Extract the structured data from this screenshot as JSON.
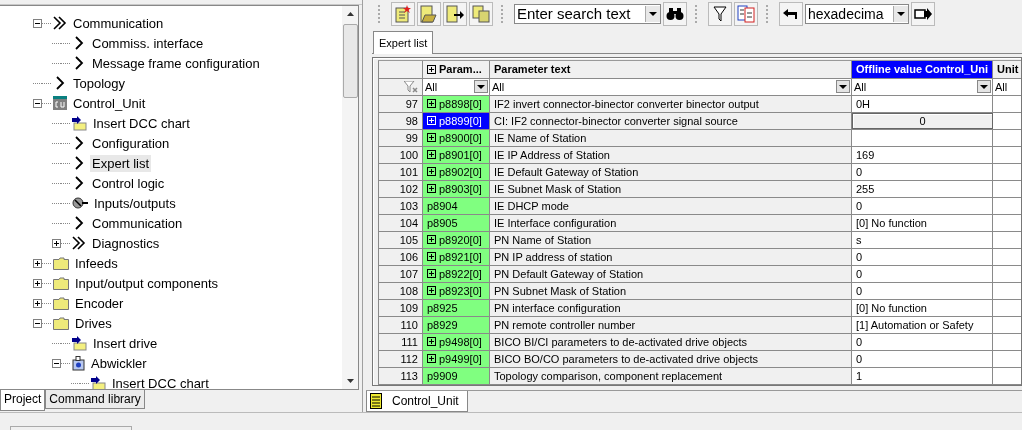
{
  "tree": [
    {
      "label": "Communication",
      "kind": "group",
      "expanded": true,
      "children": [
        {
          "label": "Commiss. interface",
          "kind": "view"
        },
        {
          "label": "Message frame configuration",
          "kind": "view"
        }
      ]
    },
    {
      "label": "Topology",
      "kind": "view"
    },
    {
      "label": "Control_Unit",
      "kind": "unit",
      "expanded": true,
      "children": [
        {
          "label": "Insert DCC chart",
          "kind": "insert"
        },
        {
          "label": "Configuration",
          "kind": "view"
        },
        {
          "label": "Expert list",
          "kind": "view",
          "selected": true
        },
        {
          "label": "Control logic",
          "kind": "view"
        },
        {
          "label": "Inputs/outputs",
          "kind": "io"
        },
        {
          "label": "Communication",
          "kind": "view"
        },
        {
          "label": "Diagnostics",
          "kind": "group",
          "expanded": false
        }
      ]
    },
    {
      "label": "Infeeds",
      "kind": "folder",
      "expanded": false
    },
    {
      "label": "Input/output components",
      "kind": "folder",
      "expanded": false
    },
    {
      "label": "Encoder",
      "kind": "folder",
      "expanded": false
    },
    {
      "label": "Drives",
      "kind": "folder",
      "expanded": true,
      "children": [
        {
          "label": "Insert drive",
          "kind": "insert"
        },
        {
          "label": "Abwickler",
          "kind": "drive",
          "expanded": true,
          "children": [
            {
              "label": "Insert DCC chart",
              "kind": "insert"
            }
          ]
        }
      ]
    }
  ],
  "left_tabs": [
    {
      "label": "Project",
      "selected": true
    },
    {
      "label": "Command library",
      "selected": false
    }
  ],
  "toolbar": {
    "search": {
      "value": "Enter search text"
    },
    "format": {
      "value": "hexadecima"
    }
  },
  "view_tabs": [
    {
      "label": "Expert list",
      "selected": true
    }
  ],
  "table": {
    "columns": [
      {
        "label": "Param...",
        "expander": true,
        "selected": false
      },
      {
        "label": "Parameter text",
        "selected": false
      },
      {
        "label": "Offline value Control_Uni",
        "selected": true
      },
      {
        "label": "Unit",
        "selected": false
      }
    ],
    "filters": [
      {
        "value": "All",
        "dropdown": true
      },
      {
        "value": "All",
        "dropdown": true
      },
      {
        "value": "All",
        "dropdown": true
      },
      {
        "value": "All",
        "dropdown": false
      }
    ],
    "rows": [
      {
        "number": "97",
        "parameter": "p8898[0]",
        "expandable": true,
        "text": "IF2 invert connector-binector converter binector output",
        "value": "0H",
        "selected": false
      },
      {
        "number": "98",
        "parameter": "p8899[0]",
        "expandable": true,
        "text": "CI: IF2 connector-binector converter signal source",
        "value": "0",
        "selected": true
      },
      {
        "number": "99",
        "parameter": "p8900[0]",
        "expandable": true,
        "text": "IE Name of Station",
        "selected": false
      },
      {
        "number": "100",
        "parameter": "p8901[0]",
        "expandable": true,
        "text": "IE IP Address of Station",
        "value": "169",
        "selected": false
      },
      {
        "number": "101",
        "parameter": "p8902[0]",
        "expandable": true,
        "text": "IE Default Gateway of Station",
        "value": "0",
        "selected": false
      },
      {
        "number": "102",
        "parameter": "p8903[0]",
        "expandable": true,
        "text": "IE Subnet Mask of Station",
        "value": "255",
        "selected": false
      },
      {
        "number": "103",
        "parameter": "p8904",
        "expandable": false,
        "text": "IE DHCP mode",
        "value": "0",
        "selected": false
      },
      {
        "number": "104",
        "parameter": "p8905",
        "expandable": false,
        "text": "IE Interface configuration",
        "value": "[0] No function",
        "selected": false
      },
      {
        "number": "105",
        "parameter": "p8920[0]",
        "expandable": true,
        "text": "PN Name of Station",
        "value": "s",
        "selected": false
      },
      {
        "number": "106",
        "parameter": "p8921[0]",
        "expandable": true,
        "text": "PN IP address of station",
        "value": "0",
        "selected": false
      },
      {
        "number": "107",
        "parameter": "p8922[0]",
        "expandable": true,
        "text": "PN Default Gateway of Station",
        "value": "0",
        "selected": false
      },
      {
        "number": "108",
        "parameter": "p8923[0]",
        "expandable": true,
        "text": "PN Subnet Mask of Station",
        "value": "0",
        "selected": false
      },
      {
        "number": "109",
        "parameter": "p8925",
        "expandable": false,
        "text": "PN interface configuration",
        "value": "[0] No function",
        "selected": false
      },
      {
        "number": "110",
        "parameter": "p8929",
        "expandable": false,
        "text": "PN remote controller number",
        "value": "[1] Automation or Safety",
        "selected": false
      },
      {
        "number": "111",
        "parameter": "p9498[0]",
        "expandable": true,
        "text": "BICO BI/CI parameters to de-activated drive objects",
        "value": "0",
        "selected": false
      },
      {
        "number": "112",
        "parameter": "p9499[0]",
        "expandable": true,
        "text": "BICO BO/CO parameters to de-activated drive objects",
        "value": "0",
        "selected": false
      },
      {
        "number": "113",
        "parameter": "p9909",
        "expandable": false,
        "text": "Topology comparison, component replacement",
        "value": "1",
        "selected": false
      }
    ]
  },
  "document_tabs": [
    {
      "label": "Control_Unit",
      "selected": true
    }
  ]
}
